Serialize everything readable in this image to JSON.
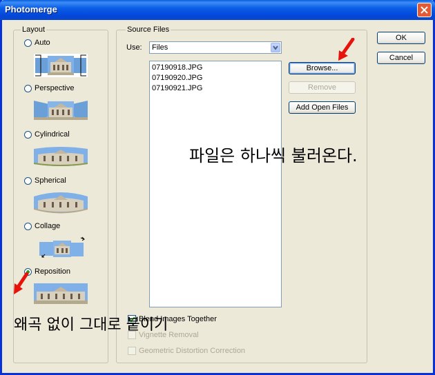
{
  "window": {
    "title": "Photomerge",
    "colors": {
      "title_bar": "#0b5ee8",
      "face": "#ece9d8",
      "close_button": "#e35b35"
    }
  },
  "layout_group": {
    "label": "Layout",
    "options": [
      {
        "label": "Auto",
        "selected": false
      },
      {
        "label": "Perspective",
        "selected": false
      },
      {
        "label": "Cylindrical",
        "selected": false
      },
      {
        "label": "Spherical",
        "selected": false
      },
      {
        "label": "Collage",
        "selected": false
      },
      {
        "label": "Reposition",
        "selected": true
      }
    ]
  },
  "source_files": {
    "label": "Source Files",
    "use_label": "Use:",
    "use_value": "Files",
    "files": [
      "07190918.JPG",
      "07190920.JPG",
      "07190921.JPG"
    ],
    "browse_button": "Browse...",
    "remove_button": "Remove",
    "add_open_files_button": "Add Open Files",
    "checkboxes": [
      {
        "label": "Blend Images Together",
        "checked": true,
        "enabled": true
      },
      {
        "label": "Vignette Removal",
        "checked": false,
        "enabled": false
      },
      {
        "label": "Geometric Distortion Correction",
        "checked": false,
        "enabled": false
      }
    ]
  },
  "dialog_buttons": {
    "ok": "OK",
    "cancel": "Cancel"
  },
  "annotations": {
    "files_note": "파일은 하나씩 불러온다.",
    "reposition_note": "왜곡 없이 그대로 붙이기",
    "arrow_color": "#e8120c"
  }
}
